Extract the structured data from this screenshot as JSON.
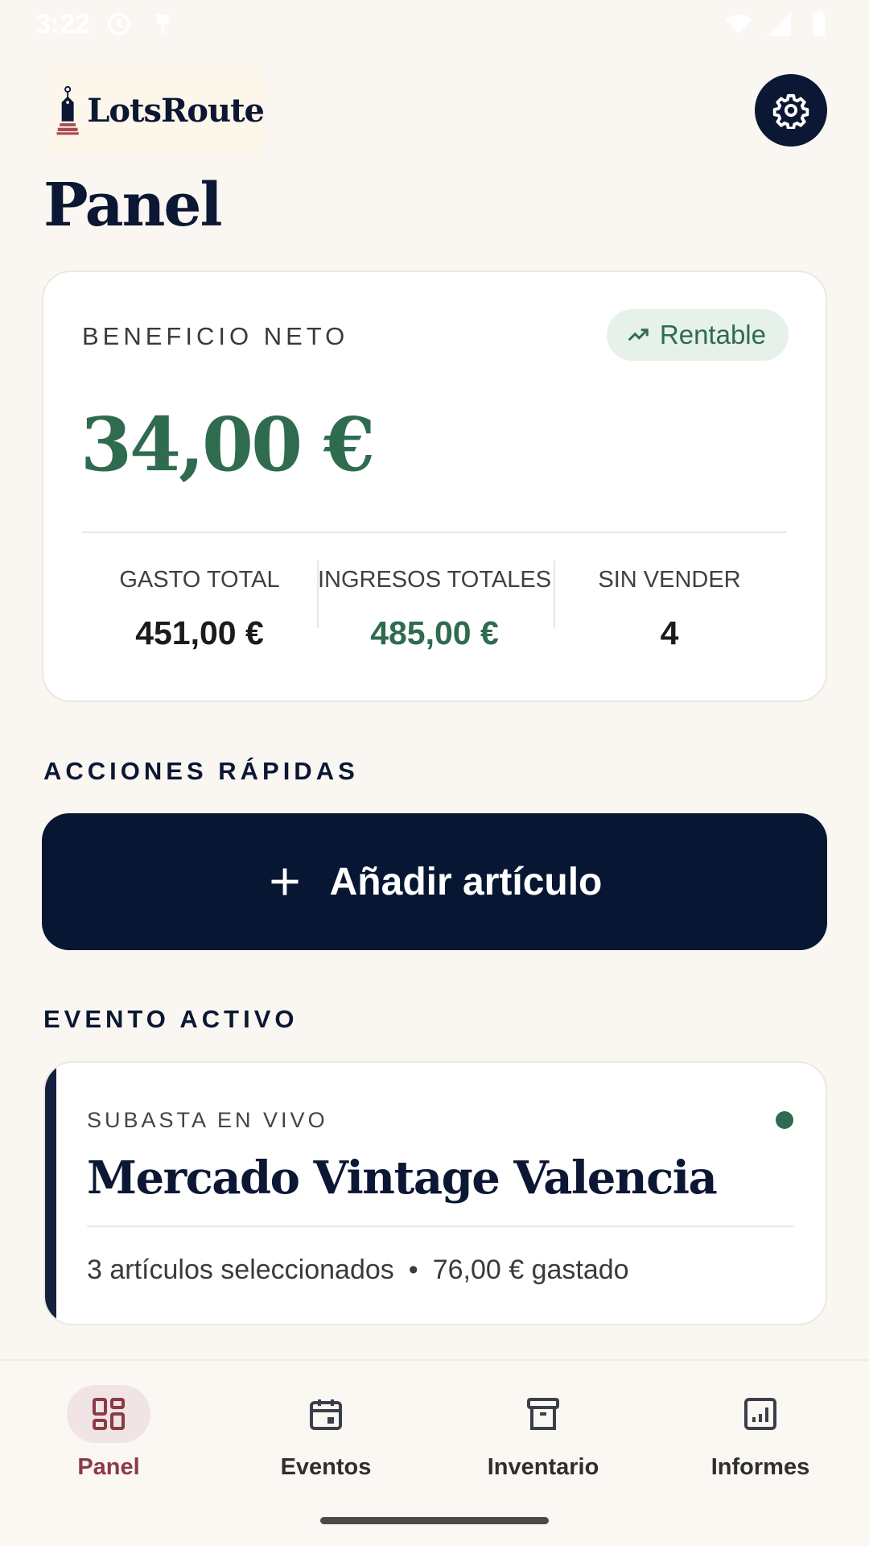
{
  "status_bar": {
    "time": "3:22"
  },
  "app": {
    "logo_text": "LotsRoute",
    "title": "Panel"
  },
  "profit": {
    "label": "BENEFICIO NETO",
    "badge": "Rentable",
    "value": "34,00 €",
    "stats": [
      {
        "label": "GASTO TOTAL",
        "value": "451,00 €"
      },
      {
        "label": "INGRESOS TOTALES",
        "value": "485,00 €"
      },
      {
        "label": "SIN VENDER",
        "value": "4"
      }
    ]
  },
  "quick_actions": {
    "heading": "ACCIONES RÁPIDAS",
    "add_label": "Añadir artículo"
  },
  "active_event": {
    "heading": "EVENTO ACTIVO",
    "kind": "SUBASTA EN VIVO",
    "name": "Mercado Vintage Valencia",
    "items": "3 artículos seleccionados",
    "separator": "•",
    "spent": "76,00 € gastado"
  },
  "nav": {
    "items": [
      {
        "label": "Panel",
        "icon": "dashboard-icon",
        "active": true
      },
      {
        "label": "Eventos",
        "icon": "calendar-icon",
        "active": false
      },
      {
        "label": "Inventario",
        "icon": "archive-icon",
        "active": false
      },
      {
        "label": "Informes",
        "icon": "chart-icon",
        "active": false
      }
    ]
  },
  "colors": {
    "background": "#faf7f2",
    "navy": "#0b1733",
    "green": "#2f6b4f",
    "active_nav": "#8b3a46"
  }
}
